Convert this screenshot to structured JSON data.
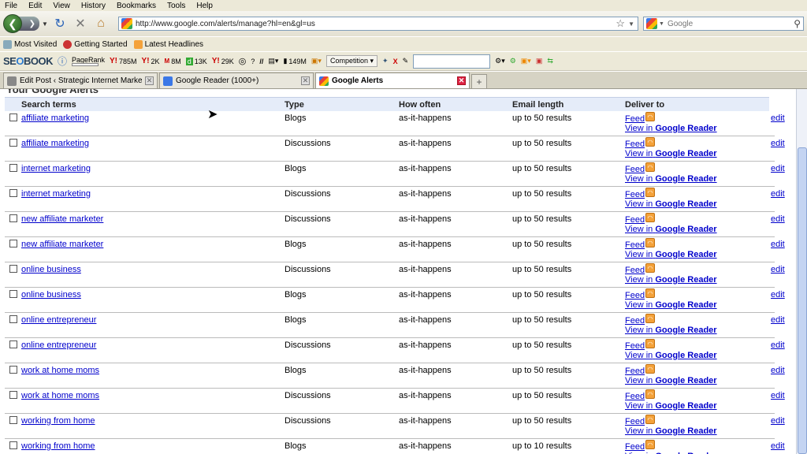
{
  "menu": [
    "File",
    "Edit",
    "View",
    "History",
    "Bookmarks",
    "Tools",
    "Help"
  ],
  "nav": {
    "url": "http://www.google.com/alerts/manage?hl=en&gl=us",
    "search_placeholder": "Google"
  },
  "bookmarks": [
    "Most Visited",
    "Getting Started",
    "Latest Headlines"
  ],
  "seo": {
    "logo_a": "SE",
    "logo_o": "O",
    "logo_b": "BOOK",
    "pagerank": "PageRank",
    "y1": "785M",
    "y2": "2K",
    "m": "8M",
    "d": "13K",
    "y3": "29K",
    "q": "?",
    "count": "149M",
    "competition": "Competition"
  },
  "tabs": [
    {
      "label": "Edit Post ‹ Strategic Internet Marketing..."
    },
    {
      "label": "Google Reader (1000+)"
    },
    {
      "label": "Google Alerts"
    }
  ],
  "page": {
    "title": "Your Google Alerts",
    "headers": {
      "search_terms": "Search terms",
      "type": "Type",
      "how_often": "How often",
      "email_length": "Email length",
      "deliver_to": "Deliver to"
    },
    "feed_label": "Feed",
    "view_in": "View in",
    "google_reader": "Google Reader",
    "edit_label": "edit",
    "alerts": [
      {
        "term": "affiliate marketing",
        "type": "Blogs",
        "often": "as-it-happens",
        "email": "up to 50 results"
      },
      {
        "term": "affiliate marketing",
        "type": "Discussions",
        "often": "as-it-happens",
        "email": "up to 50 results"
      },
      {
        "term": "internet marketing",
        "type": "Blogs",
        "often": "as-it-happens",
        "email": "up to 50 results"
      },
      {
        "term": "internet marketing",
        "type": "Discussions",
        "often": "as-it-happens",
        "email": "up to 50 results"
      },
      {
        "term": "new affiliate marketer",
        "type": "Discussions",
        "often": "as-it-happens",
        "email": "up to 50 results"
      },
      {
        "term": "new affiliate marketer",
        "type": "Blogs",
        "often": "as-it-happens",
        "email": "up to 50 results"
      },
      {
        "term": "online business",
        "type": "Discussions",
        "often": "as-it-happens",
        "email": "up to 50 results"
      },
      {
        "term": "online business",
        "type": "Blogs",
        "often": "as-it-happens",
        "email": "up to 50 results"
      },
      {
        "term": "online entrepreneur",
        "type": "Blogs",
        "often": "as-it-happens",
        "email": "up to 50 results"
      },
      {
        "term": "online entrepreneur",
        "type": "Discussions",
        "often": "as-it-happens",
        "email": "up to 50 results"
      },
      {
        "term": "work at home moms",
        "type": "Blogs",
        "often": "as-it-happens",
        "email": "up to 50 results"
      },
      {
        "term": "work at home moms",
        "type": "Discussions",
        "often": "as-it-happens",
        "email": "up to 50 results"
      },
      {
        "term": "working from home",
        "type": "Discussions",
        "often": "as-it-happens",
        "email": "up to 50 results"
      },
      {
        "term": "working from home",
        "type": "Blogs",
        "often": "as-it-happens",
        "email": "up to 10 results"
      }
    ]
  }
}
